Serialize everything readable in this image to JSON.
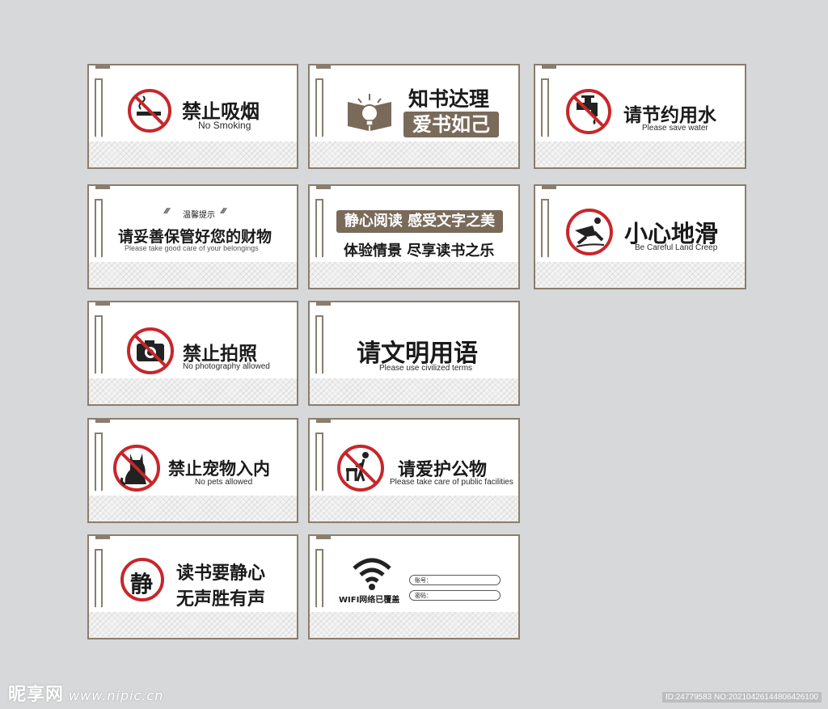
{
  "signs": [
    {
      "zh": "禁止吸烟",
      "en": "No Smoking",
      "icon": "no-smoking-icon"
    },
    {
      "zh": "知书达理",
      "zh2": "爱书如己",
      "icon": "open-book-lightbulb-icon"
    },
    {
      "zh": "请节约用水",
      "en": "Please save water",
      "icon": "no-water-tap-icon"
    },
    {
      "tip": "温馨提示",
      "zh": "请妥善保管好您的财物",
      "en": "Please take good care of your belongings"
    },
    {
      "zh": "静心阅读 感受文字之美",
      "zh2": "体验情景 尽享读书之乐"
    },
    {
      "zh": "小心地滑",
      "en": "Be Careful Land Creep",
      "icon": "slippery-floor-icon"
    },
    {
      "zh": "禁止拍照",
      "en": "No photography allowed",
      "icon": "no-camera-icon"
    },
    {
      "zh": "请文明用语",
      "en": "Please use civilized terms"
    },
    {
      "zh": "禁止宠物入内",
      "en": "No pets allowed",
      "icon": "no-pets-icon"
    },
    {
      "zh": "请爱护公物",
      "en": "Please take care of public facilities",
      "icon": "protect-facilities-icon"
    },
    {
      "zh": "读书要静心",
      "zh2": "无声胜有声",
      "badge": "静",
      "icon": "quiet-badge-icon"
    },
    {
      "caption": "WIFI网络已覆盖",
      "account_label": "账号：",
      "password_label": "密码：",
      "icon": "wifi-icon"
    }
  ],
  "watermark": {
    "brand": "昵享网",
    "url": "www.nipic.cn",
    "id_text": "ID:24779583 NO:20210426144806426100"
  },
  "colors": {
    "background": "#d7d8d9",
    "frame": "#8a7d6e",
    "brown": "#7a6a5a",
    "red": "#c8262b"
  }
}
